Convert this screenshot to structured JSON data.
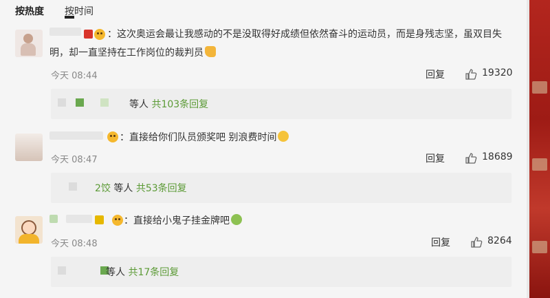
{
  "sort": {
    "hot": "按热度",
    "time": "按时间"
  },
  "comments": [
    {
      "text": "：这次奥运会最让我感动的不是没取得好成绩但依然奋斗的运动员，而是身残志坚，虽双目失明，却一直坚持在工作岗位的裁判员",
      "emoji": "thumbs-up-emoji",
      "time": "今天 08:44",
      "reply_label": "回复",
      "likes": "19320",
      "replies": {
        "prefix": "等人",
        "count": "共103条回复"
      }
    },
    {
      "text": "：直接给你们队员颁奖吧 别浪费时间",
      "emoji": "smiley-emoji",
      "time": "今天 08:47",
      "reply_label": "回复",
      "likes": "18689",
      "replies": {
        "name_frag": "2饺",
        "prefix": "等人",
        "count": "共53条回复"
      }
    },
    {
      "text": "：直接给小鬼子挂金牌吧",
      "emoji": "sick-emoji",
      "time": "今天 08:48",
      "reply_label": "回复",
      "likes": "8264",
      "replies": {
        "prefix": "等人",
        "count": "共17条回复"
      }
    }
  ],
  "colors": {
    "accent_green": "#5b9a35",
    "meta_gray": "#888888",
    "brand_red": "#b3261e"
  }
}
